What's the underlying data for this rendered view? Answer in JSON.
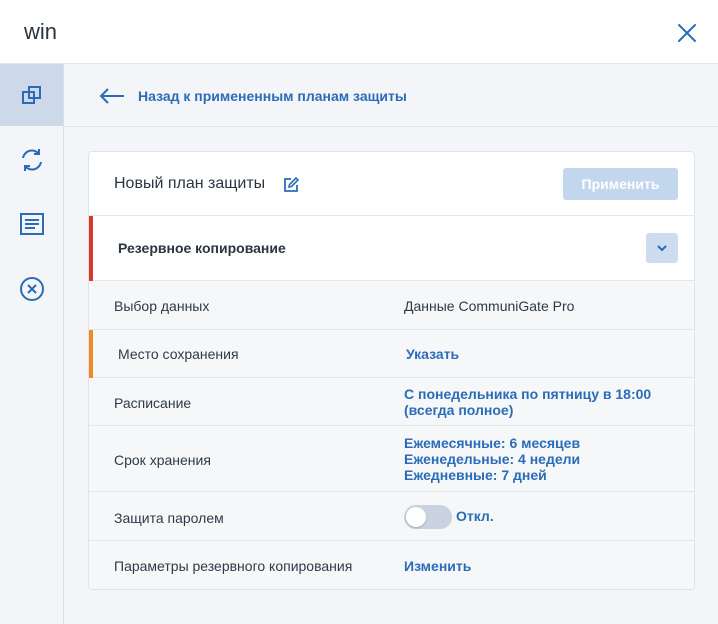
{
  "window": {
    "title": "win"
  },
  "colors": {
    "accent": "#2b6cb8",
    "section_marker": "#d6382b",
    "warning_marker": "#f08a24",
    "apply_disabled": "#c2d6ee"
  },
  "sidebar": {
    "items": [
      {
        "icon": "plans-icon",
        "active": true
      },
      {
        "icon": "refresh-icon",
        "active": false
      },
      {
        "icon": "activities-icon",
        "active": false
      },
      {
        "icon": "remove-icon",
        "active": false
      }
    ]
  },
  "nav": {
    "back_label": "Назад к примененным планам защиты"
  },
  "plan": {
    "name": "Новый план защиты",
    "apply_label": "Применить",
    "section_title": "Резервное копирование"
  },
  "settings": {
    "data_selection": {
      "label": "Выбор данных",
      "value": "Данные CommuniGate Pro"
    },
    "destination": {
      "label": "Место сохранения",
      "value": "Указать"
    },
    "schedule": {
      "label": "Расписание",
      "value_line1": "С понедельника по пятницу в 18:00",
      "value_line2": "(всегда полное)"
    },
    "retention": {
      "label": "Срок хранения",
      "monthly": "Ежемесячные: 6 месяцев",
      "weekly": "Еженедельные: 4 недели",
      "daily": "Ежедневные: 7 дней"
    },
    "password": {
      "label": "Защита паролем",
      "state": "Откл.",
      "enabled": false
    },
    "backup_options": {
      "label": "Параметры резервного копирования",
      "value": "Изменить"
    }
  }
}
